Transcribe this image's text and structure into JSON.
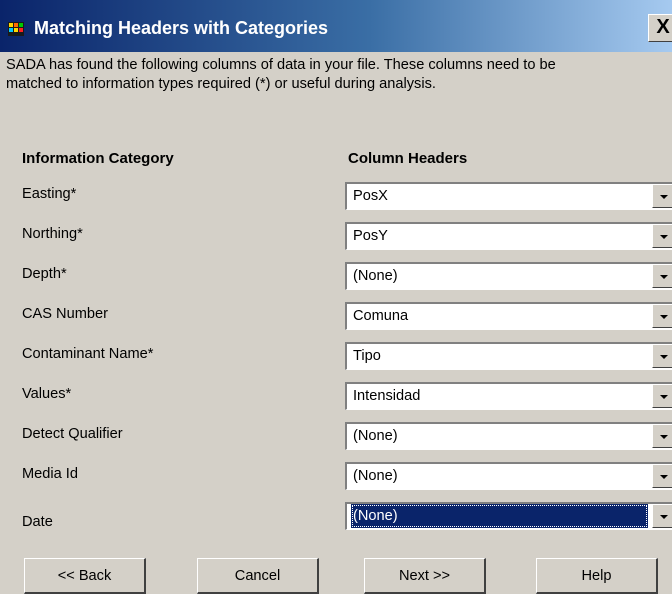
{
  "window": {
    "title": "Matching Headers with Categories",
    "close_label": "X"
  },
  "intro": {
    "line1": "SADA has found the following columns of data in your file. These columns need to be",
    "line2": "matched to information types  required (*) or  useful during analysis."
  },
  "headers": {
    "category": "Information Category",
    "column": "Column Headers"
  },
  "rows": [
    {
      "label": "Easting*",
      "value": "PosX"
    },
    {
      "label": "Northing*",
      "value": "PosY"
    },
    {
      "label": "Depth*",
      "value": "(None)"
    },
    {
      "label": "CAS Number",
      "value": "Comuna"
    },
    {
      "label": "Contaminant Name*",
      "value": "Tipo"
    },
    {
      "label": "Values*",
      "value": "Intensidad"
    },
    {
      "label": "Detect Qualifier",
      "value": "(None)"
    },
    {
      "label": "Media Id",
      "value": "(None)"
    },
    {
      "label": "Date",
      "value": "(None)"
    }
  ],
  "buttons": {
    "back": "<< Back",
    "cancel": "Cancel",
    "next": "Next >>",
    "help": "Help"
  },
  "colors": {
    "titlebar_start": "#0a246a",
    "titlebar_end": "#a6caf0",
    "selection": "#0a246a",
    "dialog_bg": "#d4d0c8"
  }
}
